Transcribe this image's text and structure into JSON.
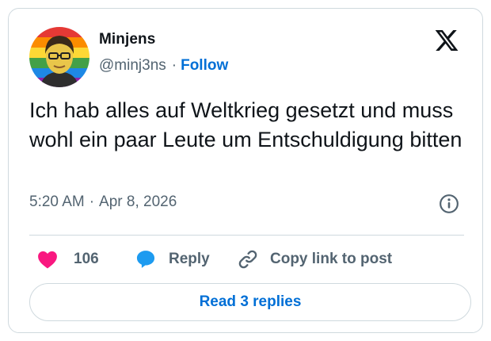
{
  "author": {
    "display_name": "Minjens",
    "handle": "@minj3ns",
    "separator": "·",
    "follow_label": "Follow",
    "avatar_icon": "avatar-cartoon-portrait-rainbow-background"
  },
  "platform": {
    "logo_icon": "x-logo"
  },
  "tweet": {
    "text": "Ich hab alles auf Weltkrieg gesetzt und muss wohl ein paar Leute um Entschuldigung bitten",
    "time": "5:20 AM",
    "separator": "·",
    "date": "Apr 8, 2026",
    "info_icon": "info-icon"
  },
  "actions": {
    "likes_count": "106",
    "like_icon": "heart-icon",
    "like_color": "#f91880",
    "reply_label": "Reply",
    "reply_icon": "speech-bubble-icon",
    "reply_color": "#1d9bf0",
    "copy_label": "Copy link to post",
    "copy_icon": "link-icon"
  },
  "replies_button": {
    "label": "Read 3 replies"
  },
  "colors": {
    "accent": "#006fd6",
    "muted_text": "#536471",
    "border": "#cfd9de"
  }
}
